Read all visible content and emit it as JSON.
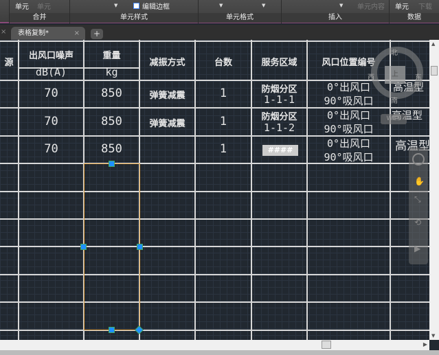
{
  "ribbon": {
    "groups": [
      {
        "label": "合并"
      },
      {
        "label": "单元样式"
      },
      {
        "label": "单元格式"
      },
      {
        "label": "插入"
      },
      {
        "label": "数据"
      }
    ],
    "buttons": {
      "cell": "单元",
      "cell_dim": "单元",
      "edit_borders": "编辑边框",
      "cell_content": "单元内容",
      "data_cell": "单元",
      "download": "下载"
    }
  },
  "tabs": {
    "active": "表格复制*",
    "close": "×",
    "add": "+"
  },
  "table": {
    "header": {
      "col0": "源",
      "noise": "出风口噪声",
      "noise_unit": "dB(A)",
      "weight": "重量",
      "weight_unit": "kg",
      "damping": "减振方式",
      "count": "台数",
      "area": "服务区域",
      "position": "风口位置编号"
    },
    "rows": [
      {
        "noise": "70",
        "weight": "850",
        "damping": "弹簧减震",
        "count": "1",
        "area1": "防烟分区",
        "area2": "1-1-1",
        "pos1": "0°出风口",
        "pos2": "90°吸风口",
        "type": "高温型"
      },
      {
        "noise": "70",
        "weight": "850",
        "damping": "弹簧减震",
        "count": "1",
        "area1": "防烟分区",
        "area2": "1-1-2",
        "pos1": "0°出风口",
        "pos2": "90°吸风口",
        "type": "高温型"
      },
      {
        "noise": "70",
        "weight": "850",
        "damping": "",
        "count": "1",
        "area1": "####",
        "area2": "",
        "pos1": "0°出风口",
        "pos2": "90°吸风口",
        "type": "高温型"
      }
    ]
  },
  "viewcube": {
    "north": "北",
    "south": "南",
    "east": "东",
    "west": "西",
    "face": "上",
    "wcs": "WCS"
  }
}
